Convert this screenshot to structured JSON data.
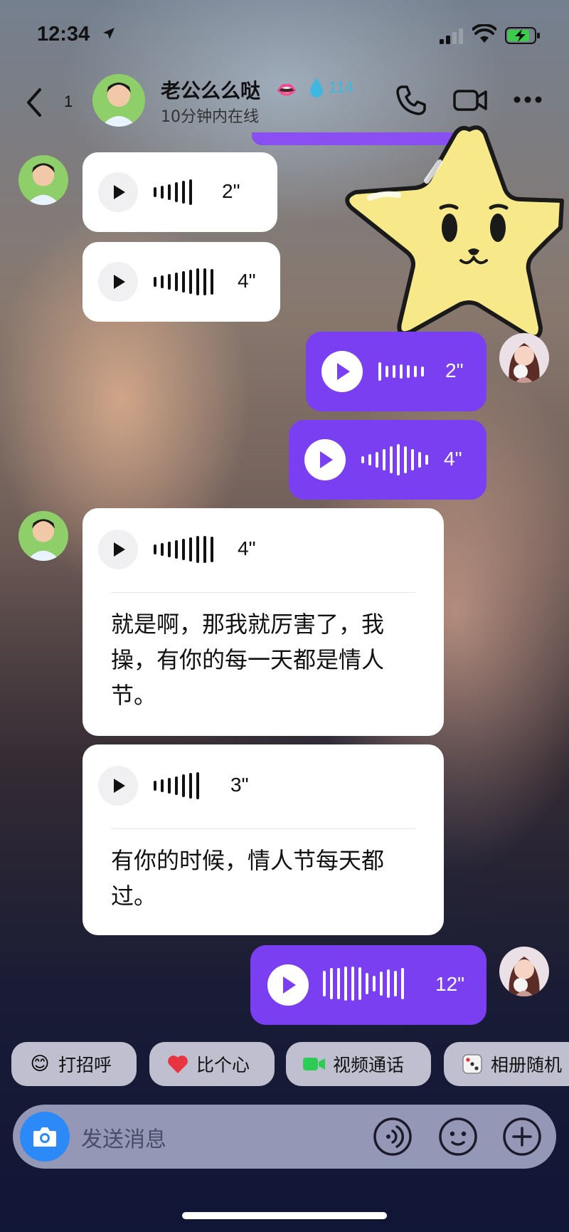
{
  "status_bar": {
    "time": "12:34"
  },
  "header": {
    "unread_count": "1",
    "contact_name": "老公么么哒",
    "lips_emoji": "👄",
    "score": "114",
    "online_status": "10分钟内在线"
  },
  "messages": [
    {
      "dir": "in",
      "duration": "2\""
    },
    {
      "dir": "in",
      "duration": "4\""
    },
    {
      "dir": "out",
      "duration": "2\""
    },
    {
      "dir": "out",
      "duration": "4\""
    },
    {
      "dir": "in",
      "duration": "4\"",
      "transcript": "就是啊，那我就厉害了，我操，有你的每一天都是情人节。"
    },
    {
      "dir": "in",
      "duration": "3\"",
      "transcript": "有你的时候，情人节每天都过。"
    },
    {
      "dir": "out",
      "duration": "12\""
    }
  ],
  "quick_replies": [
    {
      "label": "打招呼",
      "icon": "greeting-emoji-icon"
    },
    {
      "label": "比个心",
      "icon": "heart-icon"
    },
    {
      "label": "视频通话",
      "icon": "video-camera-icon"
    },
    {
      "label": "相册随机",
      "icon": "dice-icon"
    }
  ],
  "input": {
    "placeholder": "发送消息"
  },
  "colors": {
    "accent": "#7b3ff2",
    "camera": "#2b8af7",
    "score": "#3fb7e0"
  }
}
